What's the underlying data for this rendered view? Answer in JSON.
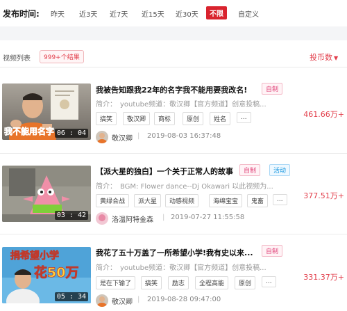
{
  "filter": {
    "label": "发布时间:",
    "options": [
      "昨天",
      "近3天",
      "近7天",
      "近15天",
      "近30天",
      "不限",
      "自定义"
    ],
    "active_index": 5
  },
  "list": {
    "title": "视频列表",
    "results_badge": "999+个结果",
    "sort_label": "投币数",
    "sort_caret": "▼"
  },
  "videos": [
    {
      "title": "我被告知跟我22年的名字我不能用要我改名!",
      "badges": [
        "自制"
      ],
      "desc": "简介：　youtube频道：敬汉卿【官方频道】创意投稿...",
      "tags": [
        "搞笑",
        "敬汉卿",
        "商标",
        "原创",
        "姓名",
        "..."
      ],
      "author": "敬汉卿",
      "datetime": "2019-08-03 16:37:48",
      "coins": "461.66万+",
      "duration": "06 : 04",
      "thumb_caption": "我不能用名字"
    },
    {
      "title": "【派大星的独白】一个关于正常人的故事",
      "badges": [
        "自制",
        "活动"
      ],
      "desc": "简介：　BGM: Flower dance--Dj Okawari 以此视频为...",
      "tags": [
        "黄绿合战",
        "派大星",
        "动感视频",
        "海绵宝宝",
        "鬼畜",
        "..."
      ],
      "author": "洛温阿特金森",
      "datetime": "2019-07-27 11:55:58",
      "coins": "377.51万+",
      "duration": "03 : 42",
      "thumb_caption": ""
    },
    {
      "title": "我花了五十万盖了一所希望小学!我有史以来...",
      "badges": [
        "自制"
      ],
      "desc": "简介：　youtube频道：敬汉卿【官方频道】创意投稿...",
      "tags": [
        "是在下输了",
        "搞笑",
        "励志",
        "全程高能",
        "原创",
        "..."
      ],
      "author": "敬汉卿",
      "datetime": "2019-08-28 09:47:00",
      "coins": "331.37万+",
      "duration": "05 : 34",
      "thumb_caption_top": "捐希望小学",
      "thumb_caption_bottom": "花50万"
    }
  ],
  "colors": {
    "accent_red": "#e23d4a",
    "filter_active_bg": "#d9232e",
    "badge_pink": "#e0457a",
    "badge_blue": "#1e9ae0"
  }
}
